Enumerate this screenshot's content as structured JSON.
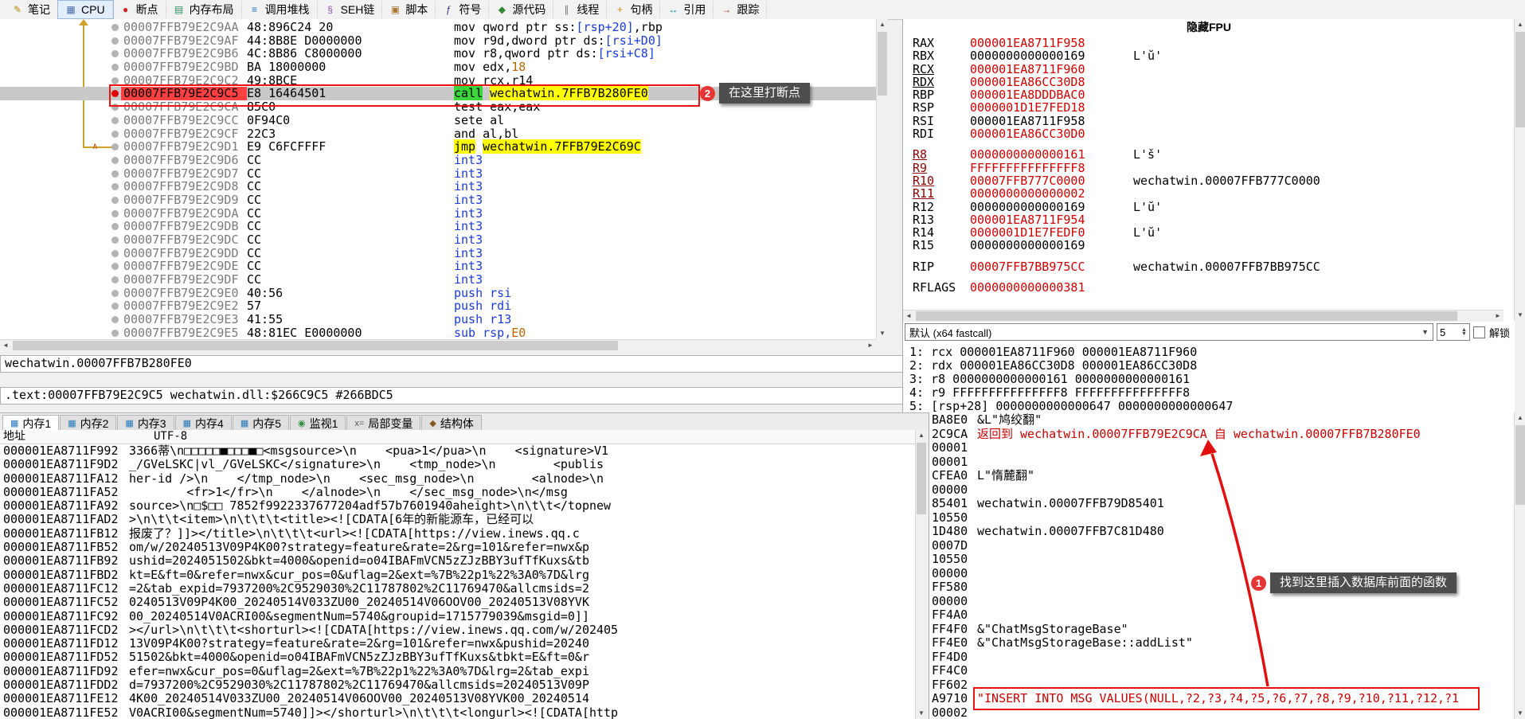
{
  "toolbar": {
    "tabs": [
      {
        "id": "notes",
        "label": "笔记",
        "icon": "notes-icon",
        "glyph": "✎",
        "color": "#b8860b"
      },
      {
        "id": "cpu",
        "label": "CPU",
        "icon": "cpu-icon",
        "glyph": "▦",
        "color": "#4a6fa5",
        "active": true
      },
      {
        "id": "breakpoints",
        "label": "断点",
        "icon": "breakpoint-icon",
        "glyph": "●",
        "color": "#cc2222"
      },
      {
        "id": "memory-map",
        "label": "内存布局",
        "icon": "memory-map-icon",
        "glyph": "▤",
        "color": "#2f8f5f"
      },
      {
        "id": "call-stack",
        "label": "调用堆栈",
        "icon": "call-stack-icon",
        "glyph": "≡",
        "color": "#2277bb"
      },
      {
        "id": "seh",
        "label": "SEH链",
        "icon": "seh-chain-icon",
        "glyph": "§",
        "color": "#8855aa"
      },
      {
        "id": "script",
        "label": "脚本",
        "icon": "script-icon",
        "glyph": "▣",
        "color": "#aa7733"
      },
      {
        "id": "symbols",
        "label": "符号",
        "icon": "symbols-icon",
        "glyph": "ƒ",
        "color": "#333388"
      },
      {
        "id": "source",
        "label": "源代码",
        "icon": "source-icon",
        "glyph": "◆",
        "color": "#338833"
      },
      {
        "id": "threads",
        "label": "线程",
        "icon": "threads-icon",
        "glyph": "∥",
        "color": "#777777"
      },
      {
        "id": "handles",
        "label": "句柄",
        "icon": "handles-icon",
        "glyph": "+",
        "color": "#cc8800"
      },
      {
        "id": "references",
        "label": "引用",
        "icon": "references-icon",
        "glyph": "↔",
        "color": "#0088aa"
      },
      {
        "id": "trace",
        "label": "跟踪",
        "icon": "trace-icon",
        "glyph": "→",
        "color": "#aa3333"
      }
    ]
  },
  "disasm": {
    "selected": 5,
    "rows": [
      {
        "addr": "00007FFB79E2C9AA",
        "bytes": "48:896C24 20",
        "bp": "gray",
        "parts": [
          [
            "mov qword ptr ss:",
            "k"
          ],
          [
            "[rsp+20]",
            "mem"
          ],
          [
            ",rbp",
            "k"
          ]
        ]
      },
      {
        "addr": "00007FFB79E2C9AF",
        "bytes": "44:8B8E D0000000",
        "bp": "gray",
        "parts": [
          [
            "mov r9d,dword ptr ds:",
            "k"
          ],
          [
            "[rsi+D0]",
            "mem"
          ]
        ]
      },
      {
        "addr": "00007FFB79E2C9B6",
        "bytes": "4C:8B86 C8000000",
        "bp": "gray",
        "parts": [
          [
            "mov r8,qword ptr ds:",
            "k"
          ],
          [
            "[rsi+C8]",
            "mem"
          ]
        ]
      },
      {
        "addr": "00007FFB79E2C9BD",
        "bytes": "BA 18000000",
        "bp": "gray",
        "parts": [
          [
            "mov edx,",
            "k"
          ],
          [
            "18",
            "num"
          ]
        ]
      },
      {
        "addr": "00007FFB79E2C9C2",
        "bytes": "49:8BCE",
        "bp": "gray",
        "parts": [
          [
            "mov rcx,r14",
            "k"
          ]
        ]
      },
      {
        "addr": "00007FFB79E2C9C5",
        "bytes": "E8 16464501",
        "bp": "red",
        "parts": [
          [
            "call",
            "cm"
          ],
          [
            " ",
            "k"
          ],
          [
            "wechatwin.7FFB7B280FE0",
            "co"
          ]
        ]
      },
      {
        "addr": "00007FFB79E2C9CA",
        "bytes": "85C0",
        "bp": "gray",
        "parts": [
          [
            "test eax,eax",
            "k"
          ]
        ]
      },
      {
        "addr": "00007FFB79E2C9CC",
        "bytes": "0F94C0",
        "bp": "gray",
        "parts": [
          [
            "sete al",
            "k"
          ]
        ]
      },
      {
        "addr": "00007FFB79E2C9CF",
        "bytes": "22C3",
        "bp": "gray",
        "parts": [
          [
            "and al,bl",
            "k"
          ]
        ]
      },
      {
        "addr": "00007FFB79E2C9D1",
        "bytes": "E9 C6FCFFFF",
        "bp": "gray",
        "ja": true,
        "parts": [
          [
            "jmp",
            "jy"
          ],
          [
            " ",
            "k"
          ],
          [
            "wechatwin.7FFB79E2C69C",
            "jy"
          ]
        ]
      },
      {
        "addr": "00007FFB79E2C9D6",
        "bytes": "CC",
        "bp": "gray",
        "parts": [
          [
            "int3",
            "blu"
          ]
        ]
      },
      {
        "addr": "00007FFB79E2C9D7",
        "bytes": "CC",
        "bp": "gray",
        "parts": [
          [
            "int3",
            "blu"
          ]
        ]
      },
      {
        "addr": "00007FFB79E2C9D8",
        "bytes": "CC",
        "bp": "gray",
        "parts": [
          [
            "int3",
            "blu"
          ]
        ]
      },
      {
        "addr": "00007FFB79E2C9D9",
        "bytes": "CC",
        "bp": "gray",
        "parts": [
          [
            "int3",
            "blu"
          ]
        ]
      },
      {
        "addr": "00007FFB79E2C9DA",
        "bytes": "CC",
        "bp": "gray",
        "parts": [
          [
            "int3",
            "blu"
          ]
        ]
      },
      {
        "addr": "00007FFB79E2C9DB",
        "bytes": "CC",
        "bp": "gray",
        "parts": [
          [
            "int3",
            "blu"
          ]
        ]
      },
      {
        "addr": "00007FFB79E2C9DC",
        "bytes": "CC",
        "bp": "gray",
        "parts": [
          [
            "int3",
            "blu"
          ]
        ]
      },
      {
        "addr": "00007FFB79E2C9DD",
        "bytes": "CC",
        "bp": "gray",
        "parts": [
          [
            "int3",
            "blu"
          ]
        ]
      },
      {
        "addr": "00007FFB79E2C9DE",
        "bytes": "CC",
        "bp": "gray",
        "parts": [
          [
            "int3",
            "blu"
          ]
        ]
      },
      {
        "addr": "00007FFB79E2C9DF",
        "bytes": "CC",
        "bp": "gray",
        "parts": [
          [
            "int3",
            "blu"
          ]
        ]
      },
      {
        "addr": "00007FFB79E2C9E0",
        "bytes": "40:56",
        "bp": "gray",
        "parts": [
          [
            "push rsi",
            "blu"
          ]
        ]
      },
      {
        "addr": "00007FFB79E2C9E2",
        "bytes": "57",
        "bp": "gray",
        "parts": [
          [
            "push rdi",
            "blu"
          ]
        ]
      },
      {
        "addr": "00007FFB79E2C9E3",
        "bytes": "41:55",
        "bp": "gray",
        "parts": [
          [
            "push r13",
            "blu"
          ]
        ]
      },
      {
        "addr": "00007FFB79E2C9E5",
        "bytes": "48:81EC E0000000",
        "bp": "gray",
        "parts": [
          [
            "sub rsp,",
            "blu"
          ],
          [
            "E0",
            "num"
          ]
        ]
      }
    ]
  },
  "registers": {
    "title": "隐藏FPU",
    "rows": [
      {
        "name": "RAX",
        "value": "000001EA8711F958",
        "vred": true,
        "note": ""
      },
      {
        "name": "RBX",
        "value": "0000000000000169",
        "vred": false,
        "note": "L'ŭ'"
      },
      {
        "name": "RCX",
        "value": "000001EA8711F960",
        "vred": true,
        "u": true,
        "note": ""
      },
      {
        "name": "RDX",
        "value": "000001EA86CC30D8",
        "vred": true,
        "u": true,
        "note": ""
      },
      {
        "name": "RBP",
        "value": "000001EA8DDDBAC0",
        "vred": true,
        "note": ""
      },
      {
        "name": "RSP",
        "value": "0000001D1E7FED18",
        "vred": true,
        "note": ""
      },
      {
        "name": "RSI",
        "value": "000001EA8711F958",
        "vred": false,
        "note": ""
      },
      {
        "name": "RDI",
        "value": "000001EA86CC30D0",
        "vred": true,
        "note": ""
      },
      {
        "gap": true
      },
      {
        "name": "R8",
        "value": "0000000000000161",
        "vred": true,
        "u": true,
        "nred": true,
        "note": "L'š'"
      },
      {
        "name": "R9",
        "value": "FFFFFFFFFFFFFFF8",
        "vred": true,
        "u": true,
        "nred": true,
        "note": ""
      },
      {
        "name": "R10",
        "value": "00007FFB777C0000",
        "vred": true,
        "u": true,
        "nred": true,
        "note": "wechatwin.00007FFB777C0000"
      },
      {
        "name": "R11",
        "value": "0000000000000002",
        "vred": true,
        "u": true,
        "nred": true,
        "note": ""
      },
      {
        "name": "R12",
        "value": "0000000000000169",
        "vred": false,
        "note": "L'ŭ'"
      },
      {
        "name": "R13",
        "value": "000001EA8711F954",
        "vred": true,
        "note": ""
      },
      {
        "name": "R14",
        "value": "0000001D1E7FEDF0",
        "vred": true,
        "note": "L'ŭ'"
      },
      {
        "name": "R15",
        "value": "0000000000000169",
        "vred": false,
        "note": ""
      },
      {
        "gap": true
      },
      {
        "name": "RIP",
        "value": "00007FFB7BB975CC",
        "vred": true,
        "note": "wechatwin.00007FFB7BB975CC"
      },
      {
        "gap": true
      },
      {
        "name": "RFLAGS",
        "value": "0000000000000381",
        "vred": true,
        "note": ""
      }
    ]
  },
  "callconv": {
    "selector": "默认 (x64 fastcall)",
    "depth": "5",
    "unlock_label": "解锁",
    "args": [
      "1: rcx 000001EA8711F960 000001EA8711F960",
      "2: rdx 000001EA86CC30D8 000001EA86CC30D8",
      "3: r8 0000000000000161 0000000000000161",
      "4: r9 FFFFFFFFFFFFFFF8 FFFFFFFFFFFFFFF8",
      "5: [rsp+28] 0000000000000647 0000000000000647"
    ]
  },
  "status": {
    "line1": "wechatwin.00007FFB7B280FE0",
    "line2": ".text:00007FFB79E2C9C5 wechatwin.dll:$266C9C5 #266BDC5"
  },
  "bottom_tabs": [
    {
      "id": "dump1",
      "label": "内存1",
      "icon": "memory-icon",
      "glyph": "▦",
      "color": "#2277bb",
      "active": true
    },
    {
      "id": "dump2",
      "label": "内存2",
      "icon": "memory-icon",
      "glyph": "▦",
      "color": "#2277bb"
    },
    {
      "id": "dump3",
      "label": "内存3",
      "icon": "memory-icon",
      "glyph": "▦",
      "color": "#2277bb"
    },
    {
      "id": "dump4",
      "label": "内存4",
      "icon": "memory-icon",
      "glyph": "▦",
      "color": "#2277bb"
    },
    {
      "id": "dump5",
      "label": "内存5",
      "icon": "memory-icon",
      "glyph": "▦",
      "color": "#2277bb"
    },
    {
      "id": "watch1",
      "label": "监视1",
      "icon": "watch-icon",
      "glyph": "◉",
      "color": "#2f8f3f"
    },
    {
      "id": "locals",
      "label": "局部变量",
      "icon": "locals-icon",
      "glyph": "x=",
      "color": "#555555"
    },
    {
      "id": "struct",
      "label": "结构体",
      "icon": "struct-icon",
      "glyph": "◆",
      "color": "#885522"
    }
  ],
  "dump": {
    "col_addr": "地址",
    "col_data": "UTF-8",
    "rows": [
      {
        "addr": "000001EA8711F992",
        "text": "3366蒂\\n□□□□□■□□□■□<msgsource>\\n    <pua>1</pua>\\n    <signature>V1"
      },
      {
        "addr": "000001EA8711F9D2",
        "text": "_/GVeLSKC|vl_/GVeLSKC</signature>\\n    <tmp_node>\\n        <publis"
      },
      {
        "addr": "000001EA8711FA12",
        "text": "her-id />\\n    </tmp_node>\\n    <sec_msg_node>\\n        <alnode>\\n"
      },
      {
        "addr": "000001EA8711FA52",
        "text": "        <fr>1</fr>\\n    </alnode>\\n    </sec_msg_node>\\n</msg"
      },
      {
        "addr": "000001EA8711FA92",
        "text": "source>\\n□$□□ 7852f9922337677204adf57b7601940aheight>\\n\\t\\t</topnew"
      },
      {
        "addr": "000001EA8711FAD2",
        "text": ">\\n\\t\\t<item>\\n\\t\\t\\t<title><![CDATA[6年的新能源车，已经可以"
      },
      {
        "addr": "000001EA8711FB12",
        "text": "报废了？]]></title>\\n\\t\\t\\t<url><![CDATA[https://view.inews.qq.c"
      },
      {
        "addr": "000001EA8711FB52",
        "text": "om/w/20240513V09P4K00?strategy=feature&rate=2&rg=101&refer=nwx&p"
      },
      {
        "addr": "000001EA8711FB92",
        "text": "ushid=2024051502&bkt=4000&openid=o04IBAFmVCN5zZJzBBY3ufTfKuxs&tb"
      },
      {
        "addr": "000001EA8711FBD2",
        "text": "kt=E&ft=0&refer=nwx&cur_pos=0&uflag=2&ext=%7B%22p1%22%3A0%7D&lrg"
      },
      {
        "addr": "000001EA8711FC12",
        "text": "=2&tab_expid=7937200%2C9529030%2C11787802%2C11769470&allcmsids=2"
      },
      {
        "addr": "000001EA8711FC52",
        "text": "0240513V09P4K00_20240514V033ZU00_20240514V06OOV00_20240513V08YVK"
      },
      {
        "addr": "000001EA8711FC92",
        "text": "00_20240514V0ACRI00&segmentNum=5740&groupid=1715779039&msgid=0]]"
      },
      {
        "addr": "000001EA8711FCD2",
        "text": "></url>\\n\\t\\t\\t<shorturl><![CDATA[https://view.inews.qq.com/w/202405"
      },
      {
        "addr": "000001EA8711FD12",
        "text": "13V09P4K00?strategy=feature&rate=2&rg=101&refer=nwx&pushid=20240"
      },
      {
        "addr": "000001EA8711FD52",
        "text": "51502&bkt=4000&openid=o04IBAFmVCN5zZJzBBY3ufTfKuxs&tbkt=E&ft=0&r"
      },
      {
        "addr": "000001EA8711FD92",
        "text": "efer=nwx&cur_pos=0&uflag=2&ext=%7B%22p1%22%3A0%7D&lrg=2&tab_expi"
      },
      {
        "addr": "000001EA8711FDD2",
        "text": "d=7937200%2C9529030%2C11787802%2C11769470&allcmsids=20240513V09P"
      },
      {
        "addr": "000001EA8711FE12",
        "text": "4K00_20240514V033ZU00_20240514V06OOV00_20240513V08YVK00_20240514"
      },
      {
        "addr": "000001EA8711FE52",
        "text": "V0ACRI00&segmentNum=5740]]></shorturl>\\n\\t\\t\\t<longurl><![CDATA[http"
      }
    ]
  },
  "stack": {
    "rows": [
      {
        "addr": "BA8E0",
        "text": "&L\"鸠绞翻\""
      },
      {
        "addr": "2C9CA",
        "text": "返回到 wechatwin.00007FFB79E2C9CA 自 wechatwin.00007FFB7B280FE0",
        "red": true
      },
      {
        "addr": "00001",
        "text": ""
      },
      {
        "addr": "00001",
        "text": ""
      },
      {
        "addr": "CFEA0",
        "text": "L\"惰麓翻\""
      },
      {
        "addr": "00000",
        "text": ""
      },
      {
        "addr": "85401",
        "text": "wechatwin.00007FFB79D85401"
      },
      {
        "addr": "10550",
        "text": ""
      },
      {
        "addr": "1D480",
        "text": "wechatwin.00007FFB7C81D480"
      },
      {
        "addr": "0007D",
        "text": ""
      },
      {
        "addr": "10550",
        "text": ""
      },
      {
        "addr": "00000",
        "text": ""
      },
      {
        "addr": "FF580",
        "text": ""
      },
      {
        "addr": "00000",
        "text": ""
      },
      {
        "addr": "FF4A0",
        "text": ""
      },
      {
        "addr": "FF4F0",
        "text": "&\"ChatMsgStorageBase\""
      },
      {
        "addr": "FF4E0",
        "text": "&\"ChatMsgStorageBase::addList\""
      },
      {
        "addr": "FF4D0",
        "text": ""
      },
      {
        "addr": "FF4C0",
        "text": ""
      },
      {
        "addr": "FF602",
        "text": ""
      },
      {
        "addr": "A9710",
        "text": "\"INSERT INTO MSG VALUES(NULL,?2,?3,?4,?5,?6,?7,?8,?9,?10,?11,?12,?1",
        "red": true
      },
      {
        "addr": "00002",
        "text": ""
      }
    ]
  },
  "annotations": {
    "bp": {
      "num": "2",
      "label": "在这里打断点"
    },
    "find": {
      "num": "1",
      "label": "找到这里插入数据库前面的函数"
    }
  }
}
